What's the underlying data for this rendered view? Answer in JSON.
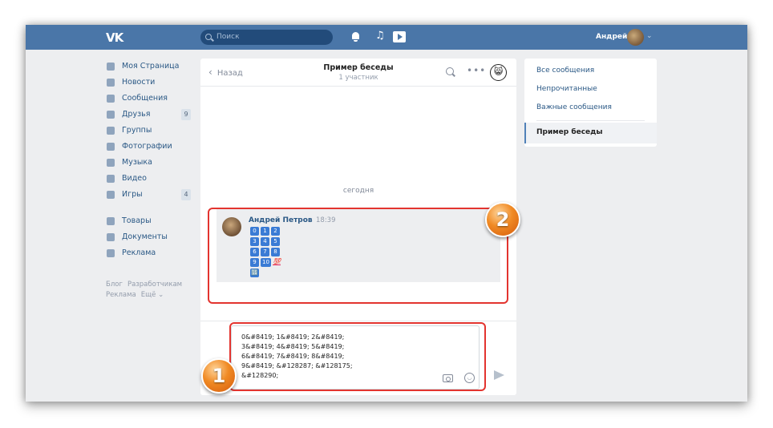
{
  "header": {
    "logo": "VK",
    "search_placeholder": "Поиск",
    "user_name": "Андрей",
    "icons": [
      "bell-icon",
      "music-icon",
      "video-icon"
    ]
  },
  "nav": {
    "items": [
      {
        "label": "Моя Страница",
        "badge": ""
      },
      {
        "label": "Новости",
        "badge": ""
      },
      {
        "label": "Сообщения",
        "badge": ""
      },
      {
        "label": "Друзья",
        "badge": "9"
      },
      {
        "label": "Группы",
        "badge": ""
      },
      {
        "label": "Фотографии",
        "badge": ""
      },
      {
        "label": "Музыка",
        "badge": ""
      },
      {
        "label": "Видео",
        "badge": ""
      },
      {
        "label": "Игры",
        "badge": "4"
      },
      {
        "label": "Товары",
        "badge": ""
      },
      {
        "label": "Документы",
        "badge": ""
      },
      {
        "label": "Реклама",
        "badge": ""
      }
    ],
    "footer": [
      "Блог",
      "Разработчикам",
      "Реклама",
      "Ещё ⌄"
    ]
  },
  "chat": {
    "back_label": "Назад",
    "title": "Пример беседы",
    "subtitle": "1 участник",
    "date_label": "сегодня",
    "message": {
      "author": "Андрей Петров",
      "time": "18:39",
      "keycaps": [
        [
          "0",
          "1",
          "2"
        ],
        [
          "3",
          "4",
          "5"
        ],
        [
          "6",
          "7",
          "8"
        ],
        [
          "9",
          "10",
          "💯"
        ],
        [
          "🔢"
        ]
      ]
    },
    "compose_text": "0&#8419; 1&#8419; 2&#8419;\n3&#8419; 4&#8419; 5&#8419;\n6&#8419; 7&#8419; 8&#8419;\n9&#8419; &#128287; &#128175;\n&#128290;"
  },
  "right_panel": {
    "links": [
      "Все сообщения",
      "Непрочитанные",
      "Важные сообщения"
    ],
    "active": "Пример беседы"
  },
  "callouts": {
    "first": "1",
    "second": "2"
  },
  "colors": {
    "brand": "#4a76a8",
    "link": "#2a5885",
    "callout": "#e3342f",
    "badge_orange": "#f08a24"
  }
}
